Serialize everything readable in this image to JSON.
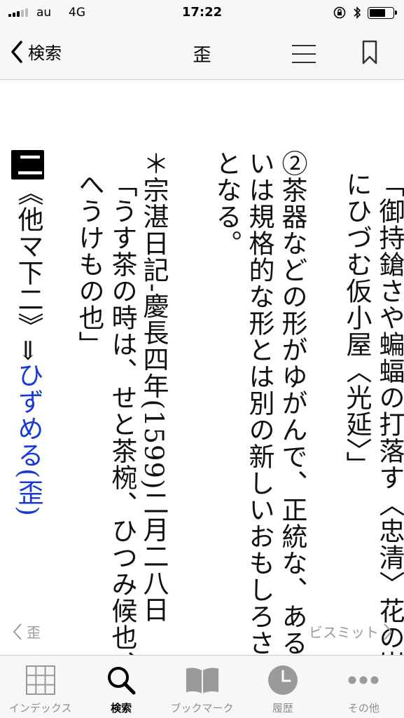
{
  "status_bar": {
    "carrier": "au",
    "network": "4G",
    "time": "17:22"
  },
  "nav": {
    "back_label": "検索",
    "title": "歪"
  },
  "body": {
    "col1": "「御持鎗さや蝙蝠の打落す〈忠清〉花の嵐にひづむ仮小屋〈光延〉」",
    "col2": "②茶器などの形がゆがんで、正統な、あるいは規格的な形とは別の新しいおもしろさとなる。",
    "col3a": "＊宗湛日記‐慶長四年(1599)二月二八日",
    "col3b": "「うす茶の時は、せと茶椀、ひつみ候也、へうけもの也」",
    "badge": "二",
    "col4_pre": "《他マ下二》⇒",
    "col4_link": "ひずめる(歪)"
  },
  "pager": {
    "prev_label": "歪",
    "next_label": "ビスミット"
  },
  "tabs": [
    {
      "label": "インデックス",
      "icon": "grid-icon"
    },
    {
      "label": "検索",
      "icon": "search-icon"
    },
    {
      "label": "ブックマーク",
      "icon": "book-icon"
    },
    {
      "label": "履歴",
      "icon": "clock-icon"
    },
    {
      "label": "その他",
      "icon": "more-icon"
    }
  ],
  "colors": {
    "link": "#1a3ad6",
    "inactive": "#8e8e93"
  }
}
